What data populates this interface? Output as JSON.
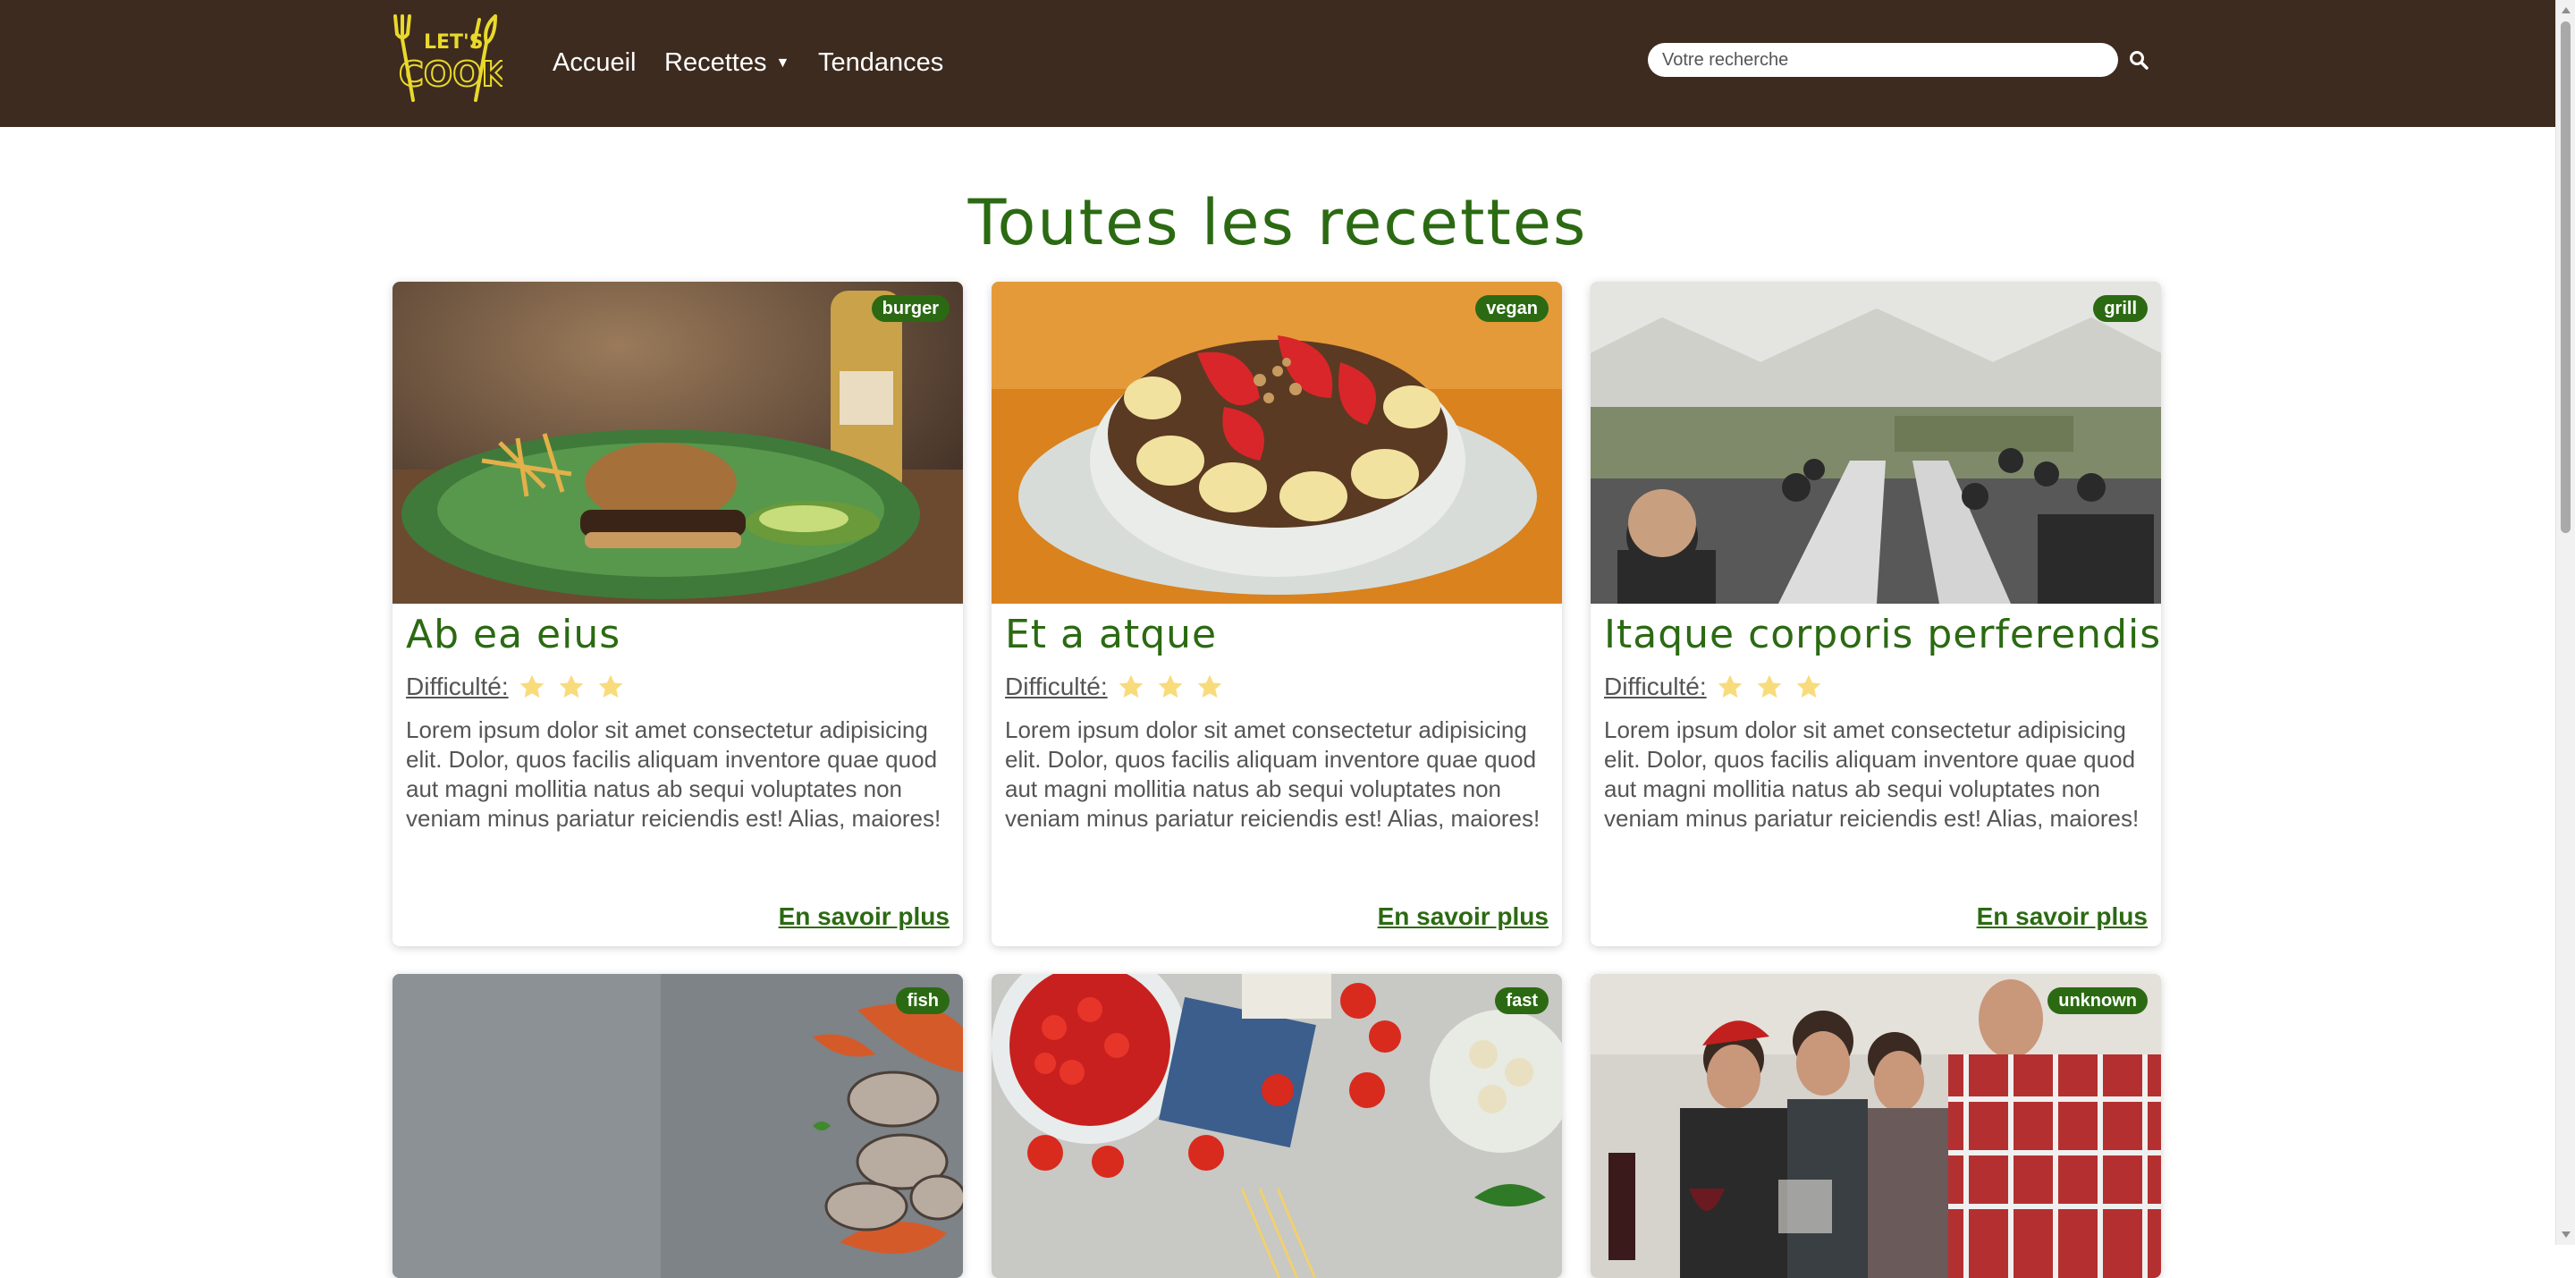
{
  "header": {
    "logo_text_top": "LET'S",
    "logo_text_bottom": "COOK",
    "nav": [
      {
        "label": "Accueil"
      },
      {
        "label": "Recettes",
        "caret": "▼"
      },
      {
        "label": "Tendances"
      }
    ],
    "search": {
      "placeholder": "Votre recherche",
      "icon": "search-icon"
    }
  },
  "main": {
    "title": "Toutes les recettes",
    "cards": [
      {
        "tag": "burger",
        "title": "Ab ea eius",
        "difficulty_label": "Difficulté:",
        "difficulty_stars": 3,
        "description": "Lorem ipsum dolor sit amet consectetur adipisicing elit. Dolor, quos facilis aliquam inventore quae quod aut magni mollitia natus ab sequi voluptates non veniam minus pariatur reiciendis est! Alias, maiores!",
        "more": "En savoir plus",
        "image": "burger with fries and avocado"
      },
      {
        "tag": "vegan",
        "title": "Et a atque",
        "difficulty_label": "Difficulté:",
        "difficulty_stars": 3,
        "description": "Lorem ipsum dolor sit amet consectetur adipisicing elit. Dolor, quos facilis aliquam inventore quae quod aut magni mollitia natus ab sequi voluptates non veniam minus pariatur reiciendis est! Alias, maiores!",
        "more": "En savoir plus",
        "image": "fruit bowl with strawberries and bananas"
      },
      {
        "tag": "grill",
        "title": "Itaque corporis perferendis",
        "difficulty_label": "Difficulté:",
        "difficulty_stars": 3,
        "description": "Lorem ipsum dolor sit amet consectetur adipisicing elit. Dolor, quos facilis aliquam inventore quae quod aut magni mollitia natus ab sequi voluptates non veniam minus pariatur reiciendis est! Alias, maiores!",
        "more": "En savoir plus",
        "image": "people dining under a tent"
      },
      {
        "tag": "fish",
        "image": "seafood on grey stone"
      },
      {
        "tag": "fast",
        "image": "tomatoes and pasta ingredients"
      },
      {
        "tag": "unknown",
        "image": "people at a dinner table"
      }
    ]
  },
  "colors": {
    "header_bg": "#3d2b1f",
    "accent_green": "#2b6a12",
    "logo_yellow": "#e8d92c",
    "star_yellow": "#f8dc7c",
    "text_gray": "#555555"
  }
}
